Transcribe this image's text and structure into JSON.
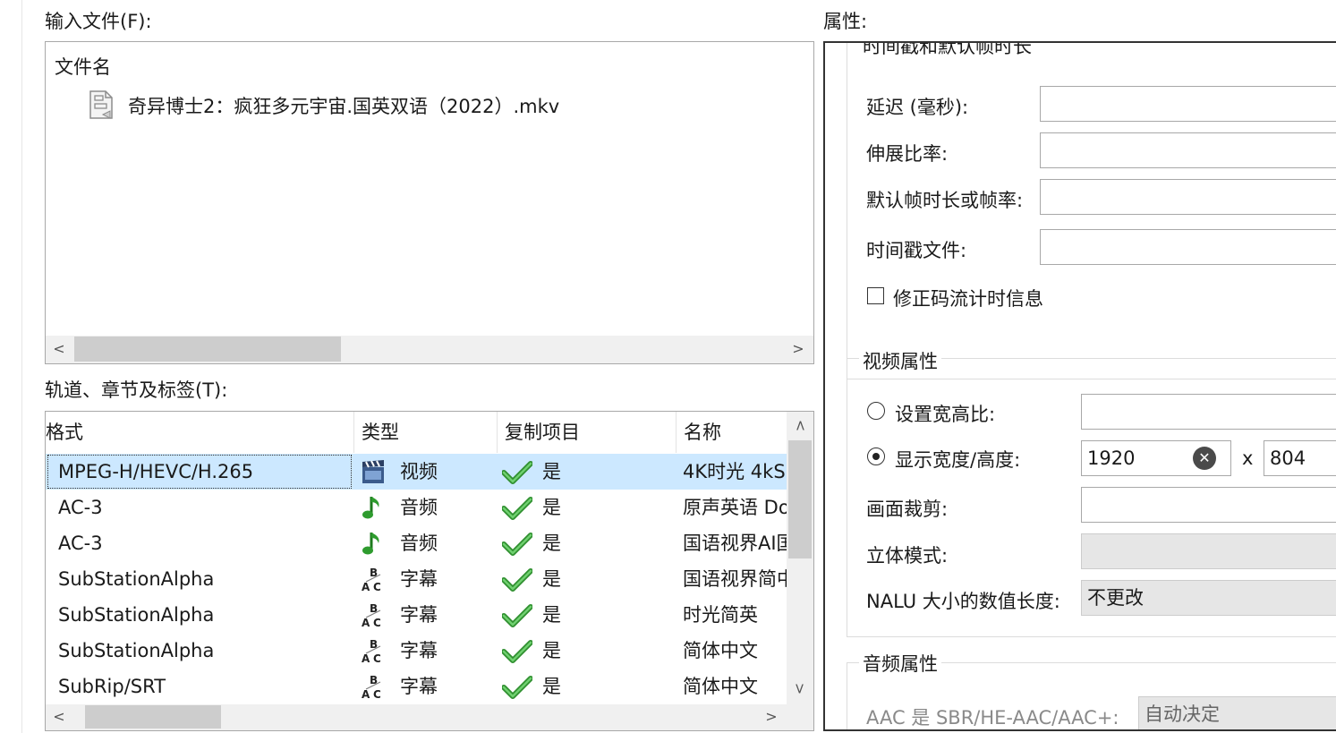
{
  "input_files": {
    "label": "输入文件(F):",
    "column_header": "文件名",
    "files": [
      {
        "name": "奇异博士2：疯狂多元宇宙.国英双语（2022）.mkv",
        "icon": "document-icon"
      }
    ]
  },
  "tracks": {
    "label": "轨道、章节及标签(T):",
    "columns": [
      "格式",
      "类型",
      "复制项目",
      "名称"
    ],
    "rows": [
      {
        "format": "MPEG-H/HEVC/H.265",
        "type": "视频",
        "type_icon": "video-clapper-icon",
        "copy": "是",
        "name": "4K时光 4kS",
        "selected": true
      },
      {
        "format": "AC-3",
        "type": "音频",
        "type_icon": "music-note-icon",
        "copy": "是",
        "name": "原声英语 Do"
      },
      {
        "format": "AC-3",
        "type": "音频",
        "type_icon": "music-note-icon",
        "copy": "是",
        "name": "国语视界AI国"
      },
      {
        "format": "SubStationAlpha",
        "type": "字幕",
        "type_icon": "subtitle-abc-icon",
        "copy": "是",
        "name": "国语视界简中"
      },
      {
        "format": "SubStationAlpha",
        "type": "字幕",
        "type_icon": "subtitle-abc-icon",
        "copy": "是",
        "name": "时光简英"
      },
      {
        "format": "SubStationAlpha",
        "type": "字幕",
        "type_icon": "subtitle-abc-icon",
        "copy": "是",
        "name": "简体中文"
      },
      {
        "format": "SubRip/SRT",
        "type": "字幕",
        "type_icon": "subtitle-abc-icon",
        "copy": "是",
        "name": "简体中文"
      }
    ]
  },
  "properties": {
    "label": "属性:",
    "timestamps_group": {
      "title": "时间戳和默认帧时长",
      "delay_label": "延迟 (毫秒):",
      "stretch_label": "伸展比率:",
      "default_duration_label": "默认帧时长或帧率:",
      "timestamp_file_label": "时间戳文件:",
      "fix_bitstream_label": "修正码流计时信息"
    },
    "video_group": {
      "title": "视频属性",
      "aspect_ratio_label": "设置宽高比:",
      "display_size_label": "显示宽度/高度:",
      "display_width": "1920",
      "display_height": "804",
      "size_separator": "x",
      "crop_label": "画面裁剪:",
      "stereo_label": "立体模式:",
      "nalu_label": "NALU 大小的数值长度:",
      "nalu_value": "不更改"
    },
    "audio_group": {
      "title": "音频属性",
      "sbr_label": "AAC 是 SBR/HE-AAC/AAC+:",
      "sbr_value": "自动决定"
    }
  },
  "colors": {
    "selection": "#cce8ff",
    "check_green": "#3aa53a",
    "border": "#a8a8a8"
  }
}
